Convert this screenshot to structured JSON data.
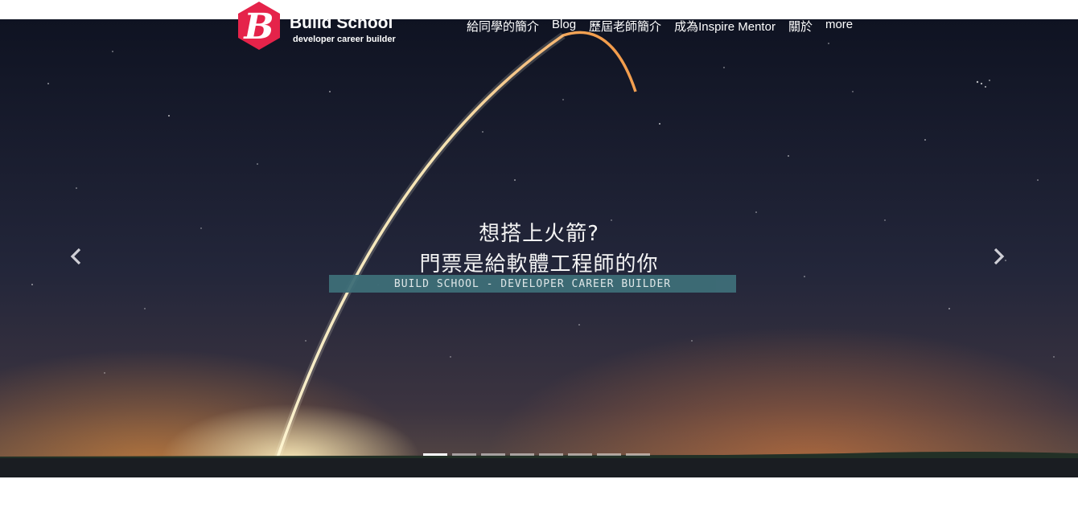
{
  "brand": {
    "title": "Build School",
    "subtitle": "developer career builder",
    "logo_letter": "B",
    "logo_color": "#e5234a"
  },
  "nav": {
    "items": [
      {
        "label": "給同學的簡介"
      },
      {
        "label": "Blog"
      },
      {
        "label": "歷屆老師簡介"
      },
      {
        "label": "成為Inspire Mentor"
      },
      {
        "label": "關於"
      },
      {
        "label": "more"
      }
    ]
  },
  "hero": {
    "line1": "想搭上火箭?",
    "line2": "門票是給軟體工程師的你",
    "tagline": "BUILD SCHOOL - DEVELOPER CAREER BUILDER",
    "prev_icon": "chevron-left-icon",
    "next_icon": "chevron-right-icon",
    "slides_count": 8,
    "active_slide": 1
  }
}
